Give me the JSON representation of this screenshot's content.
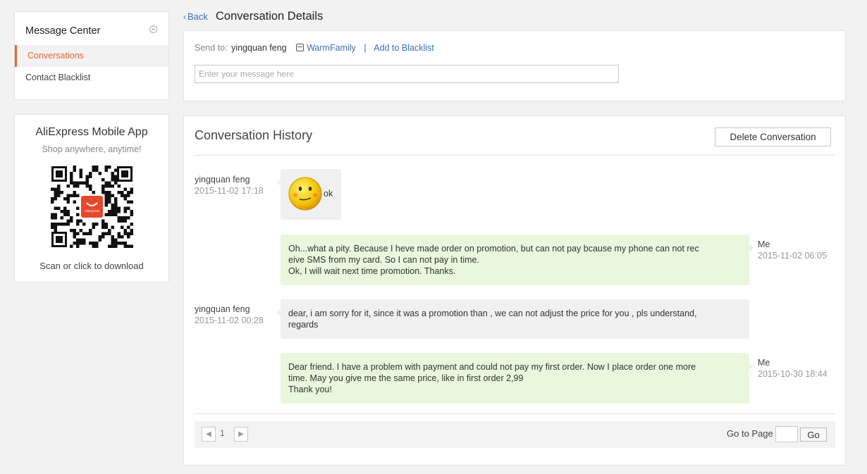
{
  "menu": {
    "title": "Message Center",
    "items": [
      {
        "label": "Conversations",
        "active": true
      },
      {
        "label": "Contact Blacklist",
        "active": false
      }
    ]
  },
  "app_promo": {
    "title": "AliExpress Mobile App",
    "subtitle": "Shop anywhere, anytime!",
    "qr_logo_text": "AliExpress",
    "scan_text": "Scan or click to download"
  },
  "header": {
    "back_label": "Back",
    "title": "Conversation Details"
  },
  "send": {
    "label": "Send to:",
    "recipient": "yingquan feng",
    "store_name": "WarmFamily",
    "separator": "|",
    "blacklist_link": "Add to Blacklist",
    "input_placeholder": "Enter your message here",
    "input_value": ""
  },
  "history": {
    "title": "Conversation History",
    "delete_label": "Delete Conversation",
    "messages": [
      {
        "sender": "yingquan feng",
        "time": "2015-11-02 17:18",
        "direction": "in",
        "emoticon": "smiley-face-icon",
        "text": "ok"
      },
      {
        "sender": "Me",
        "time": "2015-11-02 06:05",
        "direction": "out",
        "lines": [
          "Oh...what a pity. Because I heve made order on promotion, but can not pay bcause my phone can not rec",
          "eive SMS from my card. So I can not pay in time.",
          "Ok, I will wait next time promotion. Thanks."
        ]
      },
      {
        "sender": "yingquan feng",
        "time": "2015-11-02 00:28",
        "direction": "in",
        "lines": [
          "dear, i am sorry for it, since it was a promotion than , we can not adjust the price for you , pls understand,",
          "regards"
        ]
      },
      {
        "sender": "Me",
        "time": "2015-10-30 18:44",
        "direction": "out",
        "lines": [
          "Dear friend. I have a problem with payment and could not pay my first order. Now I place order one more",
          "time. May you give me the same price, like in first order 2,99",
          "Thank you!"
        ]
      }
    ]
  },
  "pagination": {
    "prev_icon": "chevron-left-icon",
    "next_icon": "chevron-right-icon",
    "current_page": "1",
    "goto_label": "Go to Page",
    "goto_value": "",
    "go_label": "Go"
  },
  "colors": {
    "accent": "#e8652c",
    "link": "#3b6fbd",
    "bubble_in": "#f0f0f0",
    "bubble_out": "#e9f7dd"
  }
}
